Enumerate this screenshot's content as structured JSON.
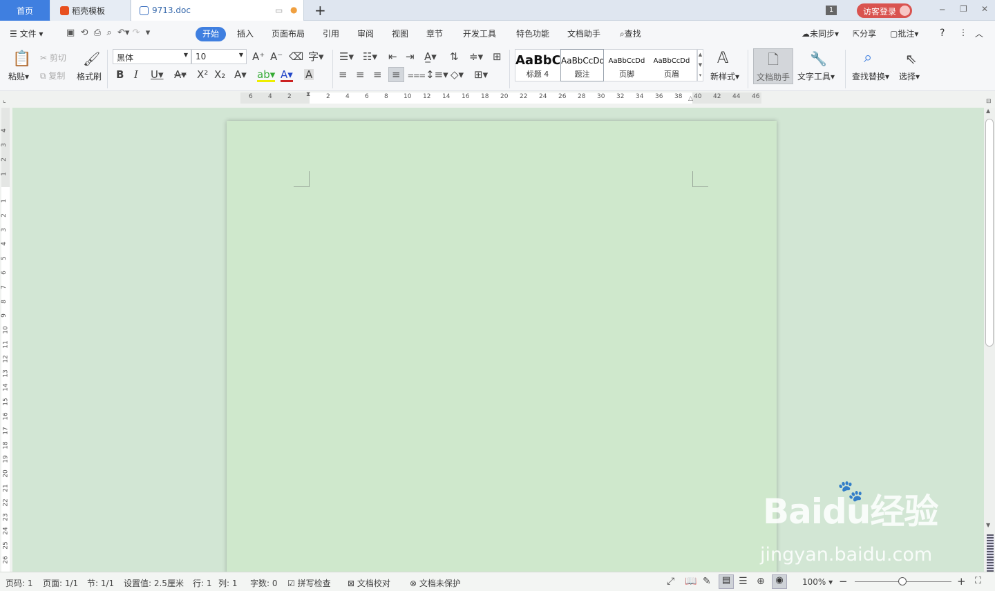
{
  "tabs": {
    "home": "首页",
    "template": "稻壳模板",
    "doc": "9713.doc",
    "new_tab": "+",
    "page_count": "1"
  },
  "window": {
    "login": "访客登录",
    "minimize": "─",
    "restore": "❐",
    "close": "✕"
  },
  "menu": {
    "file": "文件",
    "items": [
      "开始",
      "插入",
      "页面布局",
      "引用",
      "审阅",
      "视图",
      "章节",
      "开发工具",
      "特色功能",
      "文档助手"
    ],
    "active": "开始",
    "find": "查找",
    "sync": "未同步",
    "share": "分享",
    "comment": "批注",
    "help": "?"
  },
  "ribbon": {
    "paste": "粘贴",
    "cut": "剪切",
    "copy": "复制",
    "format_painter": "格式刷",
    "font_name": "黑体",
    "font_size": "10",
    "styles": [
      {
        "preview": "AaBbC",
        "label": "标题 4"
      },
      {
        "preview": "AaBbCcDd",
        "label": "题注"
      },
      {
        "preview": "AaBbCcDd",
        "label": "页脚"
      },
      {
        "preview": "AaBbCcDd",
        "label": "页眉"
      }
    ],
    "new_style": "新样式",
    "doc_assistant": "文档助手",
    "text_tool": "文字工具",
    "find_replace": "查找替换",
    "select": "选择"
  },
  "ruler": {
    "h_ticks": [
      "6",
      "4",
      "2",
      "2",
      "4",
      "6",
      "8",
      "10",
      "12",
      "14",
      "16",
      "18",
      "20",
      "22",
      "24",
      "26",
      "28",
      "30",
      "32",
      "34",
      "36",
      "38",
      "40",
      "42",
      "44",
      "46"
    ],
    "v_ticks": [
      "4",
      "3",
      "2",
      "1",
      "1",
      "2",
      "3",
      "4",
      "5",
      "6",
      "7",
      "8",
      "9",
      "10",
      "11",
      "12",
      "13",
      "14",
      "15",
      "16",
      "17",
      "18",
      "19",
      "20",
      "21",
      "22",
      "23",
      "24",
      "25",
      "26"
    ]
  },
  "status": {
    "page_no": "页码: 1",
    "pages": "页面: 1/1",
    "section": "节: 1/1",
    "setting": "设置值: 2.5厘米",
    "row": "行: 1",
    "col": "列: 1",
    "words": "字数: 0",
    "spell": "拼写检查",
    "proof": "文档校对",
    "protect": "文档未保护",
    "zoom": "100%"
  },
  "watermark": {
    "brand": "Baidu经验",
    "url": "jingyan.baidu.com"
  },
  "colors": {
    "accent": "#3f7fe0",
    "page_bg": "#cfe8cc",
    "workspace_bg": "#d2e6d4",
    "login_bg": "#d9534f"
  }
}
